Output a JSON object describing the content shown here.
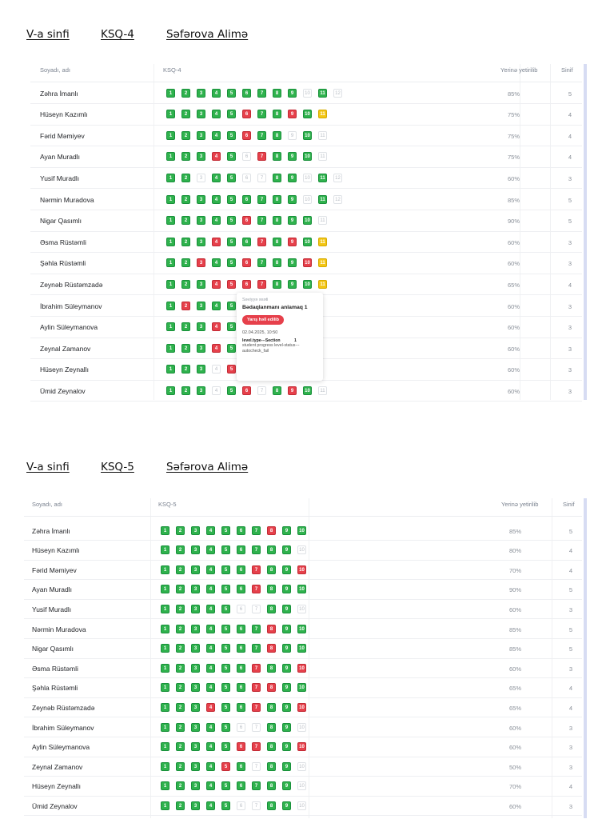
{
  "sections": [
    {
      "heading": {
        "class": "V-a sinfi",
        "subject": "KSQ-4",
        "teacher": "Səfərova Alimə"
      },
      "columns": {
        "name": "Soyadı, adı",
        "topic": "KSQ-4",
        "completed": "Yerinə yetirilib",
        "grade": "Sinif"
      },
      "rows": [
        {
          "name": "Zəhra İmanlı",
          "levels": "gggggggggwgw",
          "pct": "85%",
          "grade": "5"
        },
        {
          "name": "Hüseyn Kazımlı",
          "levels": "gggggrggrgy",
          "pct": "75%",
          "grade": "4"
        },
        {
          "name": "Fərid Məmiyev",
          "levels": "gggggrggwgw",
          "pct": "75%",
          "grade": "4"
        },
        {
          "name": "Ayan Muradlı",
          "levels": "gggrgwrgggw",
          "pct": "75%",
          "grade": "4"
        },
        {
          "name": "Yusif Muradlı",
          "levels": "ggwggwwggwgw",
          "pct": "60%",
          "grade": "3"
        },
        {
          "name": "Nərmin Muradova",
          "levels": "gggggggggwgw",
          "pct": "85%",
          "grade": "5"
        },
        {
          "name": "Nigar Qasımlı",
          "levels": "gggggrggggw",
          "pct": "90%",
          "grade": "5"
        },
        {
          "name": "Əsma Rüstəmli",
          "levels": "gggrggrgrgy",
          "pct": "60%",
          "grade": "3"
        },
        {
          "name": "Şəhla Rüstəmli",
          "levels": "ggrggrgggry",
          "pct": "60%",
          "grade": "3"
        },
        {
          "name": "Zeynəb Rüstəmzadə",
          "levels": "gggrrrrgggy",
          "pct": "65%",
          "grade": "4"
        },
        {
          "name": "İbrahim Süleymanov",
          "levels": "grggg",
          "pct": "60%",
          "grade": "3"
        },
        {
          "name": "Aylin Süleymanova",
          "levels": "gggrg",
          "pct": "60%",
          "grade": "3"
        },
        {
          "name": "Zeynal Zamanov",
          "levels": "gggrg",
          "pct": "60%",
          "grade": "3"
        },
        {
          "name": "Hüseyn Zeynallı",
          "levels": "gggwr",
          "pct": "60%",
          "grade": "3"
        },
        {
          "name": "Ümid Zeynalov",
          "levels": "gggwgrwgrgw",
          "pct": "60%",
          "grade": "3"
        }
      ]
    },
    {
      "heading": {
        "class": "V-a sinfi",
        "subject": "KSQ-5",
        "teacher": "Səfərova Alimə"
      },
      "columns": {
        "name": "Soyadı, adı",
        "topic": "KSQ-5",
        "completed": "Yerinə yetirilib",
        "grade": "Sinif"
      },
      "rows": [
        {
          "name": "Zəhra İmanlı",
          "levels": "gggggggrgg",
          "pct": "85%",
          "grade": "5"
        },
        {
          "name": "Hüseyn Kazımlı",
          "levels": "gggggggggw",
          "pct": "80%",
          "grade": "4"
        },
        {
          "name": "Fərid Məmiyev",
          "levels": "ggggggrggr",
          "pct": "70%",
          "grade": "4"
        },
        {
          "name": "Ayan Muradlı",
          "levels": "ggggggrggg",
          "pct": "90%",
          "grade": "5"
        },
        {
          "name": "Yusif Muradlı",
          "levels": "gggggwwggw",
          "pct": "60%",
          "grade": "3"
        },
        {
          "name": "Nərmin Muradova",
          "levels": "gggggggrgg",
          "pct": "85%",
          "grade": "5"
        },
        {
          "name": "Nigar Qasımlı",
          "levels": "gggggggrgg",
          "pct": "85%",
          "grade": "5"
        },
        {
          "name": "Əsma Rüstəmli",
          "levels": "ggggggrggr",
          "pct": "60%",
          "grade": "3"
        },
        {
          "name": "Şəhla Rüstəmli",
          "levels": "ggggggrrgg",
          "pct": "65%",
          "grade": "4"
        },
        {
          "name": "Zeynəb Rüstəmzadə",
          "levels": "gggrggrggr",
          "pct": "65%",
          "grade": "4"
        },
        {
          "name": "İbrahim Süleymanov",
          "levels": "gggggwwggw",
          "pct": "60%",
          "grade": "3"
        },
        {
          "name": "Aylin Süleymanova",
          "levels": "gggggrrggr",
          "pct": "60%",
          "grade": "3"
        },
        {
          "name": "Zeynal Zamanov",
          "levels": "ggggrgwggw",
          "pct": "50%",
          "grade": "3"
        },
        {
          "name": "Hüseyn Zeynallı",
          "levels": "gggggggggw",
          "pct": "70%",
          "grade": "4"
        },
        {
          "name": "Ümid Zeynalov",
          "levels": "gggggwwggw",
          "pct": "60%",
          "grade": "3"
        }
      ]
    }
  ],
  "tooltip": {
    "label": "Səviyyə əsəti",
    "title": "Bədaqlanmanı anlamaq 1",
    "button": "Yarış həll edilib",
    "date": "02.04.2025, 10:50",
    "line1": "level.type---Section",
    "line1_value": "1",
    "line2": "student progress level-status---",
    "line3": "autocheck_fail"
  }
}
